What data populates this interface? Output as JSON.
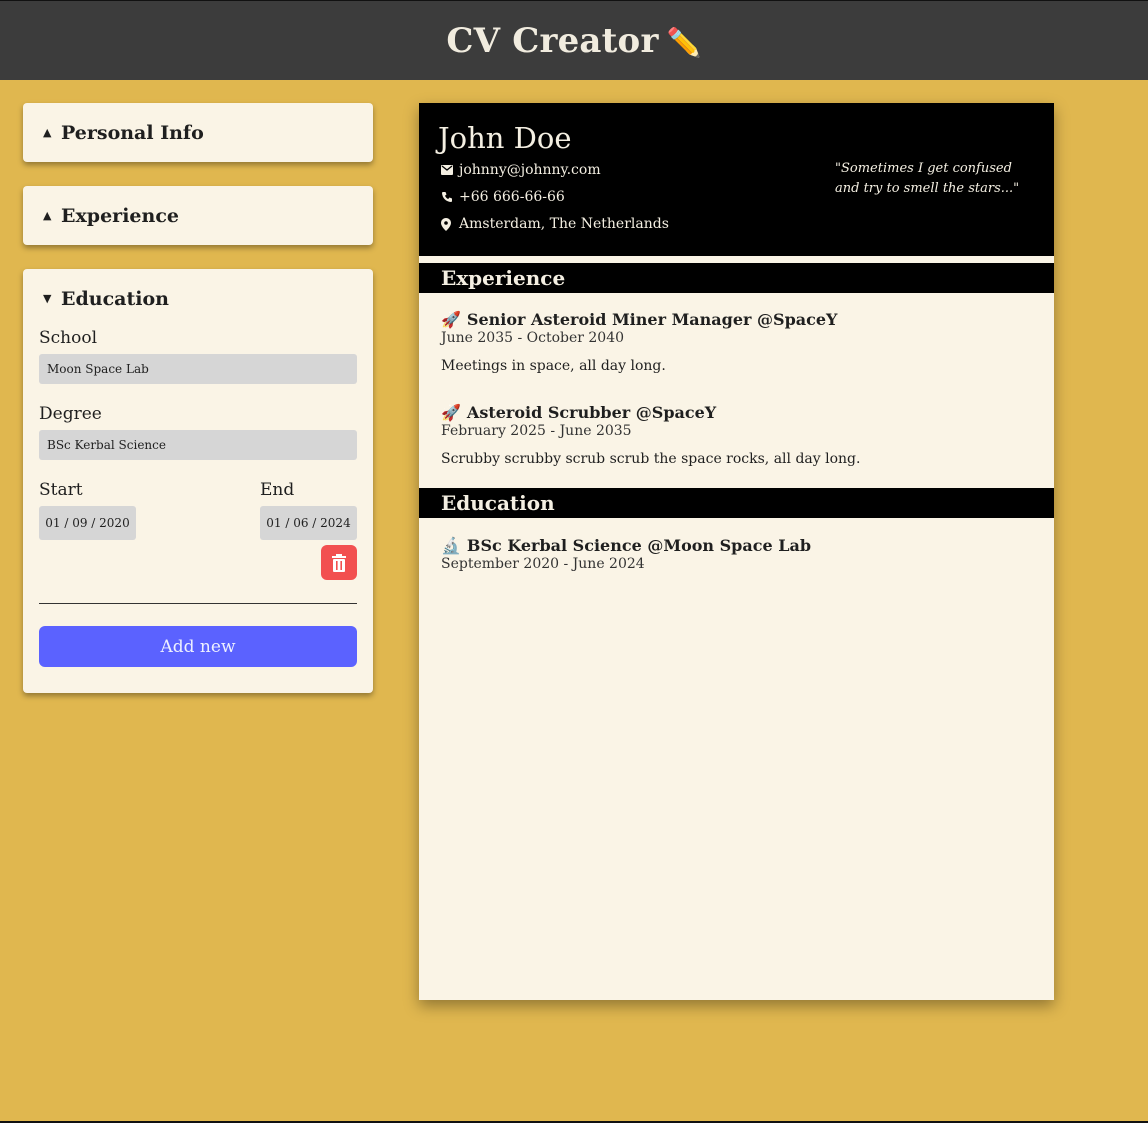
{
  "app": {
    "title": "CV Creator",
    "title_emoji": "✏️"
  },
  "sidebar": {
    "personal": {
      "label": "Personal Info",
      "state": "collapsed"
    },
    "experience": {
      "label": "Experience",
      "state": "collapsed"
    },
    "education": {
      "label": "Education",
      "state": "expanded",
      "school_label": "School",
      "school_value": "Moon Space Lab",
      "degree_label": "Degree",
      "degree_value": "BSc Kerbal Science",
      "start_label": "Start",
      "start_value": "01 / 09 / 2020",
      "end_label": "End",
      "end_value": "01 / 06 / 2024",
      "add_label": "Add new"
    }
  },
  "cv": {
    "name": "John Doe",
    "email": "johnny@johnny.com",
    "phone": "+66 666-66-66",
    "location": "Amsterdam, The Netherlands",
    "quote": "\"Sometimes I get confused and try to smell the stars...\"",
    "experience_heading": "Experience",
    "experience": [
      {
        "emoji": "🚀",
        "title": "Senior Asteroid Miner Manager @SpaceY",
        "dates": "June 2035 - October 2040",
        "desc": "Meetings in space, all day long."
      },
      {
        "emoji": "🚀",
        "title": "Asteroid Scrubber @SpaceY",
        "dates": "February 2025 - June 2035",
        "desc": "Scrubby scrubby scrub scrub the space rocks, all day long."
      }
    ],
    "education_heading": "Education",
    "education": [
      {
        "emoji": "🔬",
        "title": "BSc Kerbal Science @Moon Space Lab",
        "dates": "September 2020 - June 2024"
      }
    ]
  },
  "colors": {
    "background": "#e0b74f",
    "header": "#3c3c3c",
    "panel": "#faf4e6",
    "accent_button": "#5b62ff",
    "delete_button": "#f25050"
  },
  "icons": [
    "pencil-icon",
    "caret-up-icon",
    "caret-down-icon",
    "trash-icon",
    "mail-icon",
    "phone-icon",
    "location-pin-icon",
    "rocket-icon",
    "microscope-icon"
  ]
}
